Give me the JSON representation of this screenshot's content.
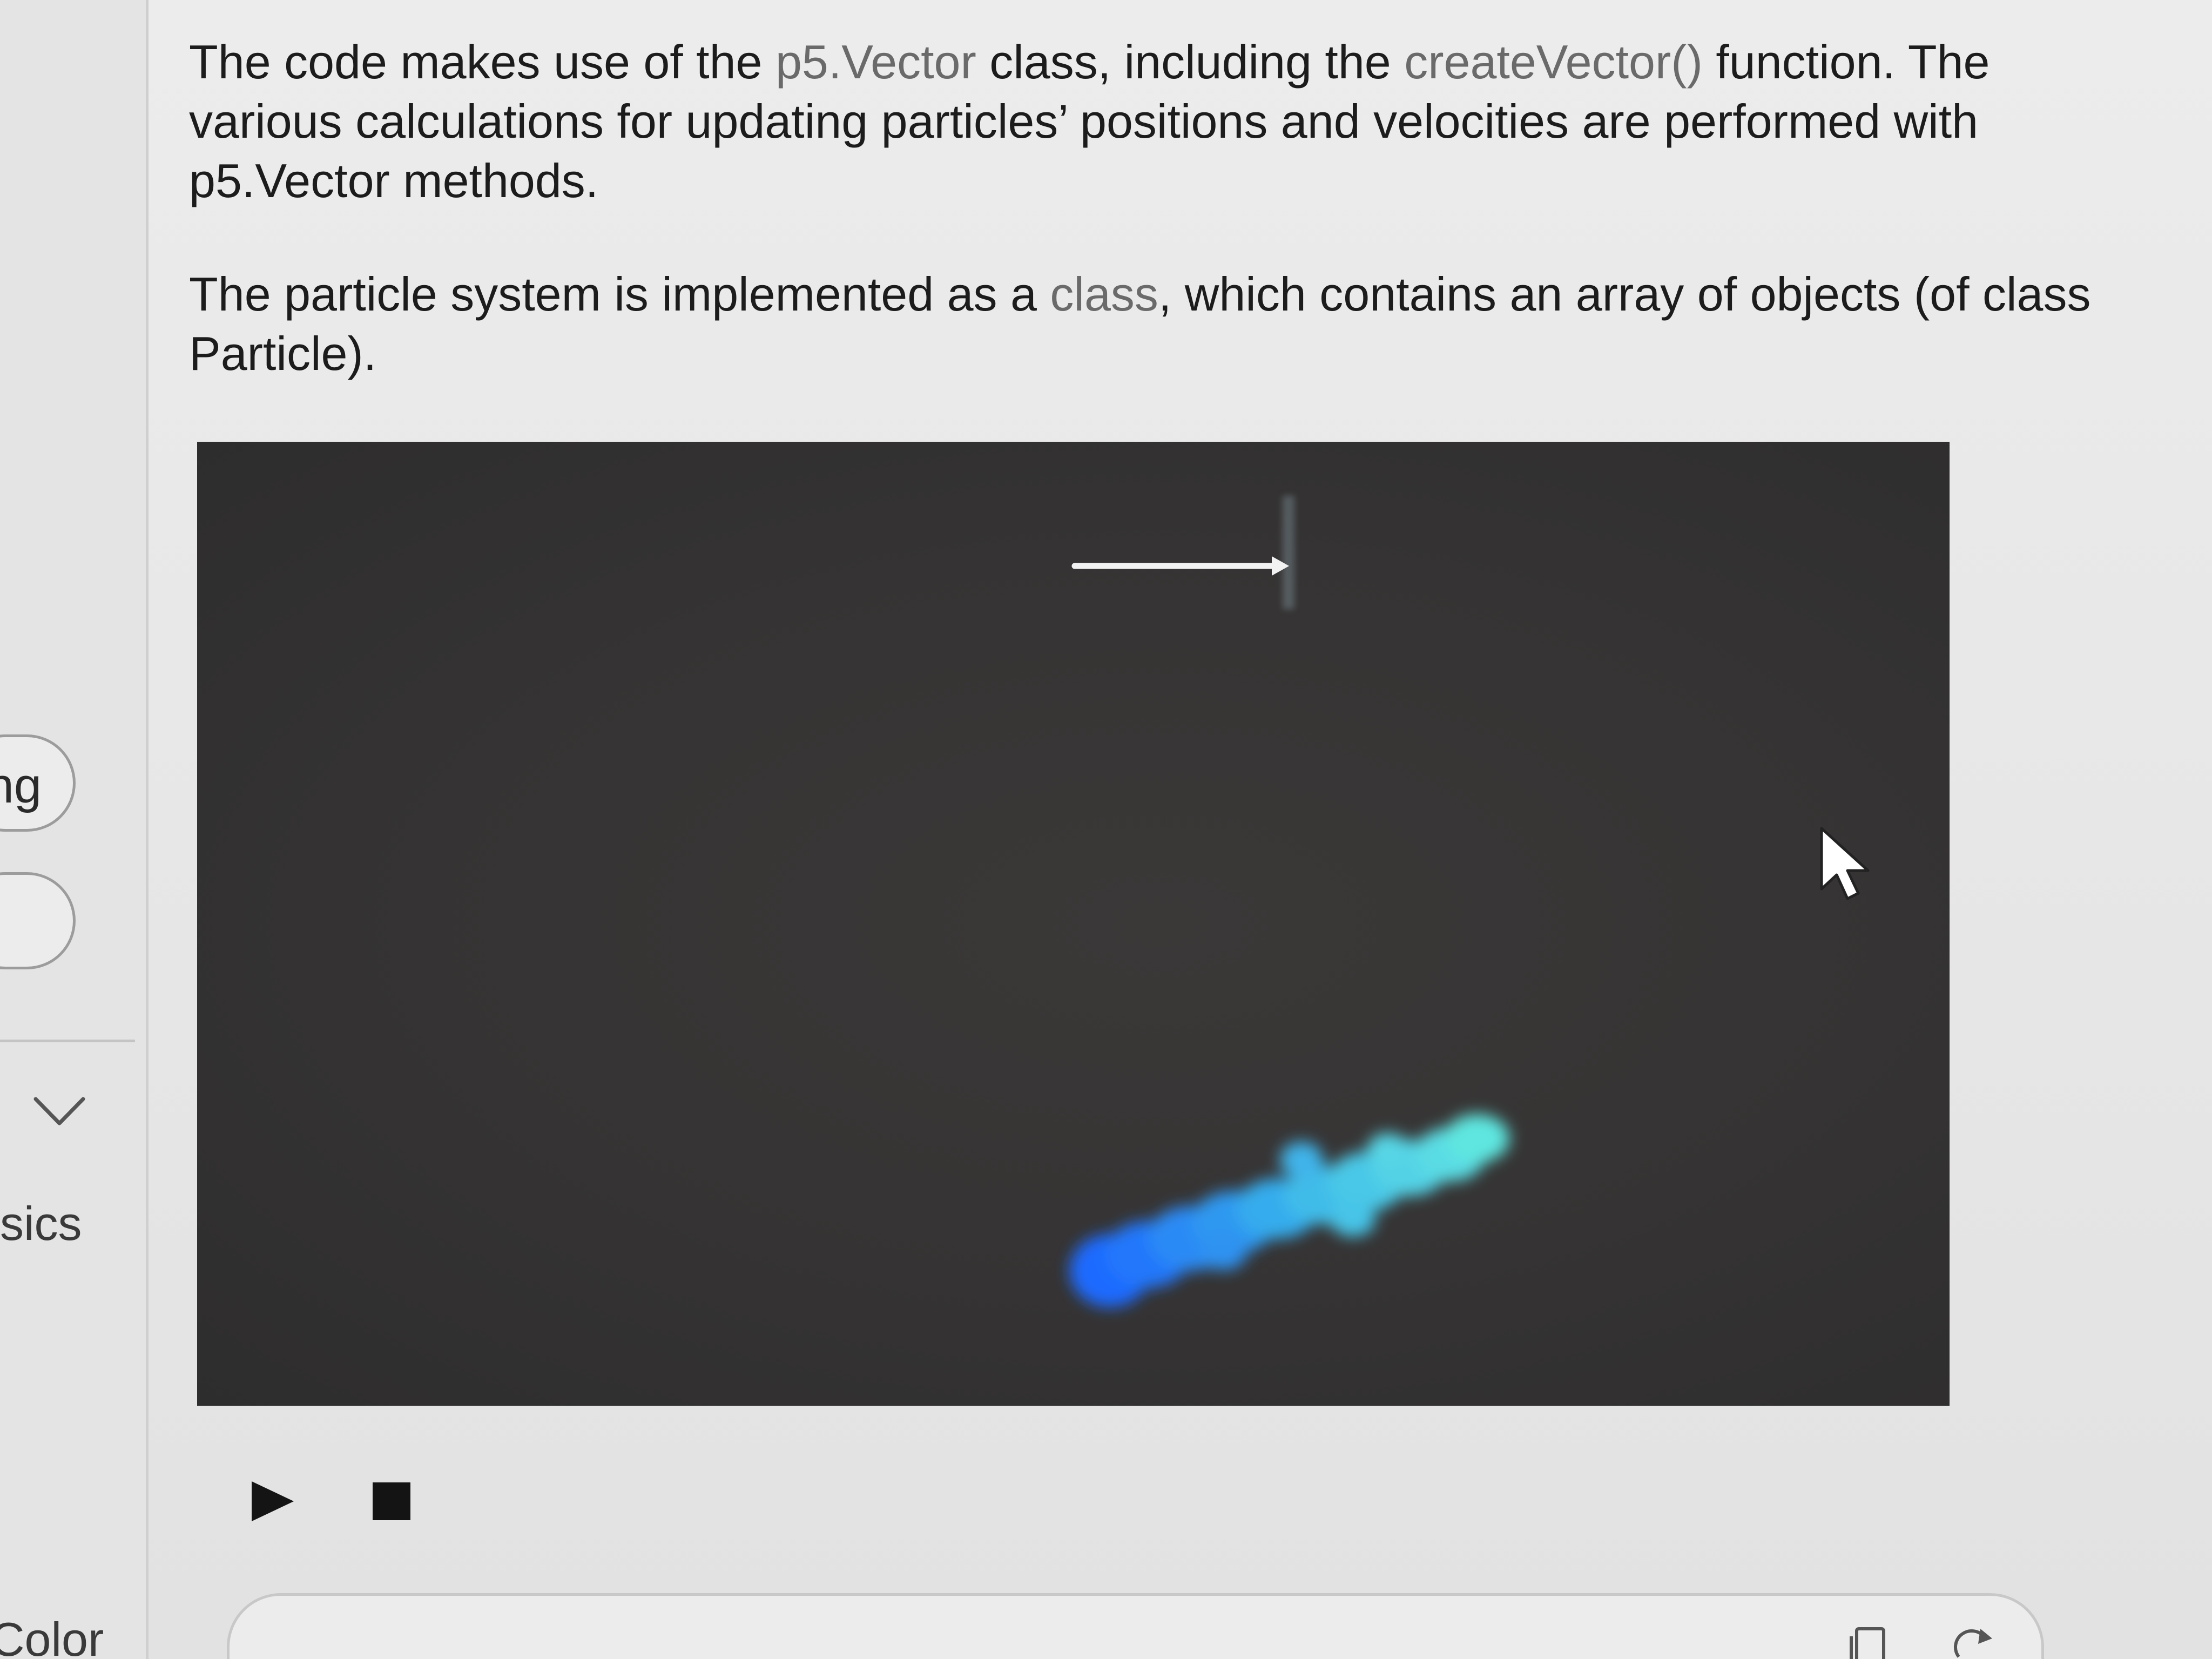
{
  "sidebar": {
    "pill_1_label": "ng",
    "pill_2_label": "",
    "section_label": "sics",
    "color_label": "Color"
  },
  "content": {
    "para1": {
      "t1": "The code makes use of the ",
      "c1": "p5.Vector",
      "t2": " class, including the ",
      "c2": "createVector()",
      "t3": " function. The various calculations for updating particles’ positions and velocities are performed with p5.Vector methods."
    },
    "para2": {
      "t1": "The particle system is implemented as a ",
      "c1": "class",
      "t2": ", which contains an array of objects (of class Particle)."
    }
  },
  "sketch": {
    "background_color": "#353333",
    "arrow_color": "#ffffff",
    "particle_colors": [
      "#1e6bff",
      "#2b9af0",
      "#4fd0e8",
      "#5ee6e0"
    ]
  },
  "controls": {
    "play_icon": "play-icon",
    "stop_icon": "stop-icon"
  }
}
